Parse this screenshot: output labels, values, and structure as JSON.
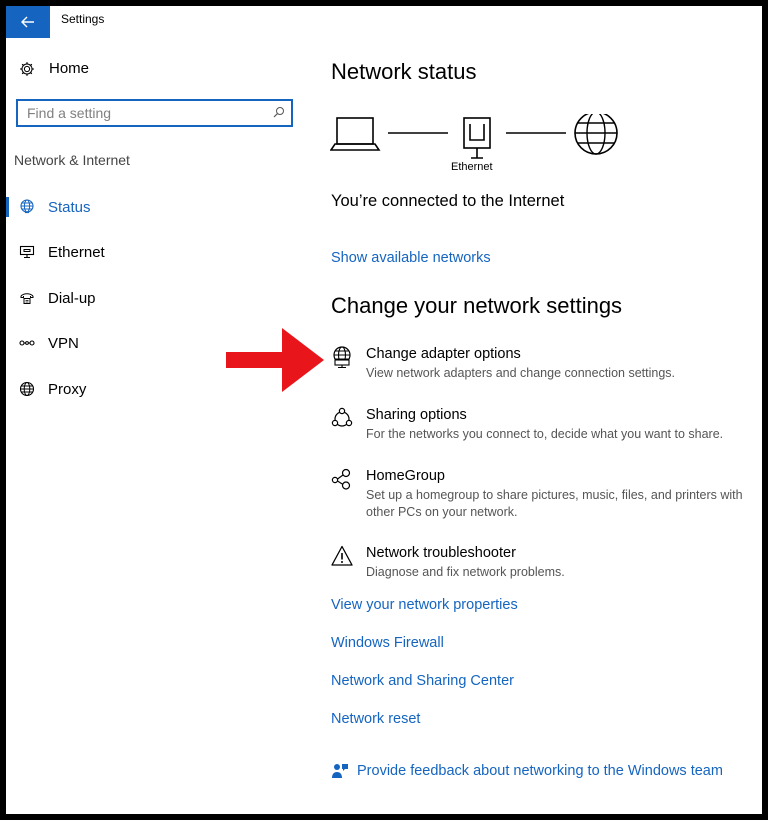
{
  "window": {
    "title": "Settings",
    "back_icon": "back-arrow-icon"
  },
  "sidebar": {
    "home_label": "Home",
    "search_placeholder": "Find a setting",
    "section_heading": "Network & Internet",
    "items": [
      {
        "label": "Status",
        "icon": "globe-status-icon",
        "active": true
      },
      {
        "label": "Ethernet",
        "icon": "ethernet-icon",
        "active": false
      },
      {
        "label": "Dial-up",
        "icon": "dialup-icon",
        "active": false
      },
      {
        "label": "VPN",
        "icon": "vpn-icon",
        "active": false
      },
      {
        "label": "Proxy",
        "icon": "globe-icon",
        "active": false
      }
    ]
  },
  "main": {
    "network_status_heading": "Network status",
    "ethernet_label": "Ethernet",
    "connected_text": "You’re connected to the Internet",
    "show_networks_link": "Show available networks",
    "change_settings_heading": "Change your network settings",
    "options": [
      {
        "title": "Change adapter options",
        "desc": "View network adapters and change connection settings.",
        "icon": "adapter-globe-icon"
      },
      {
        "title": "Sharing options",
        "desc": "For the networks you connect to, decide what you want to share.",
        "icon": "share-icon"
      },
      {
        "title": "HomeGroup",
        "desc": "Set up a homegroup to share pictures, music, files, and printers with other PCs on your network.",
        "icon": "homegroup-icon"
      },
      {
        "title": "Network troubleshooter",
        "desc": "Diagnose and fix network problems.",
        "icon": "warning-icon"
      }
    ],
    "links": [
      "View your network properties",
      "Windows Firewall",
      "Network and Sharing Center",
      "Network reset"
    ],
    "feedback_link": "Provide feedback about networking to the Windows team"
  },
  "colors": {
    "accent": "#1565c0",
    "annotation_arrow": "#e8161b"
  }
}
